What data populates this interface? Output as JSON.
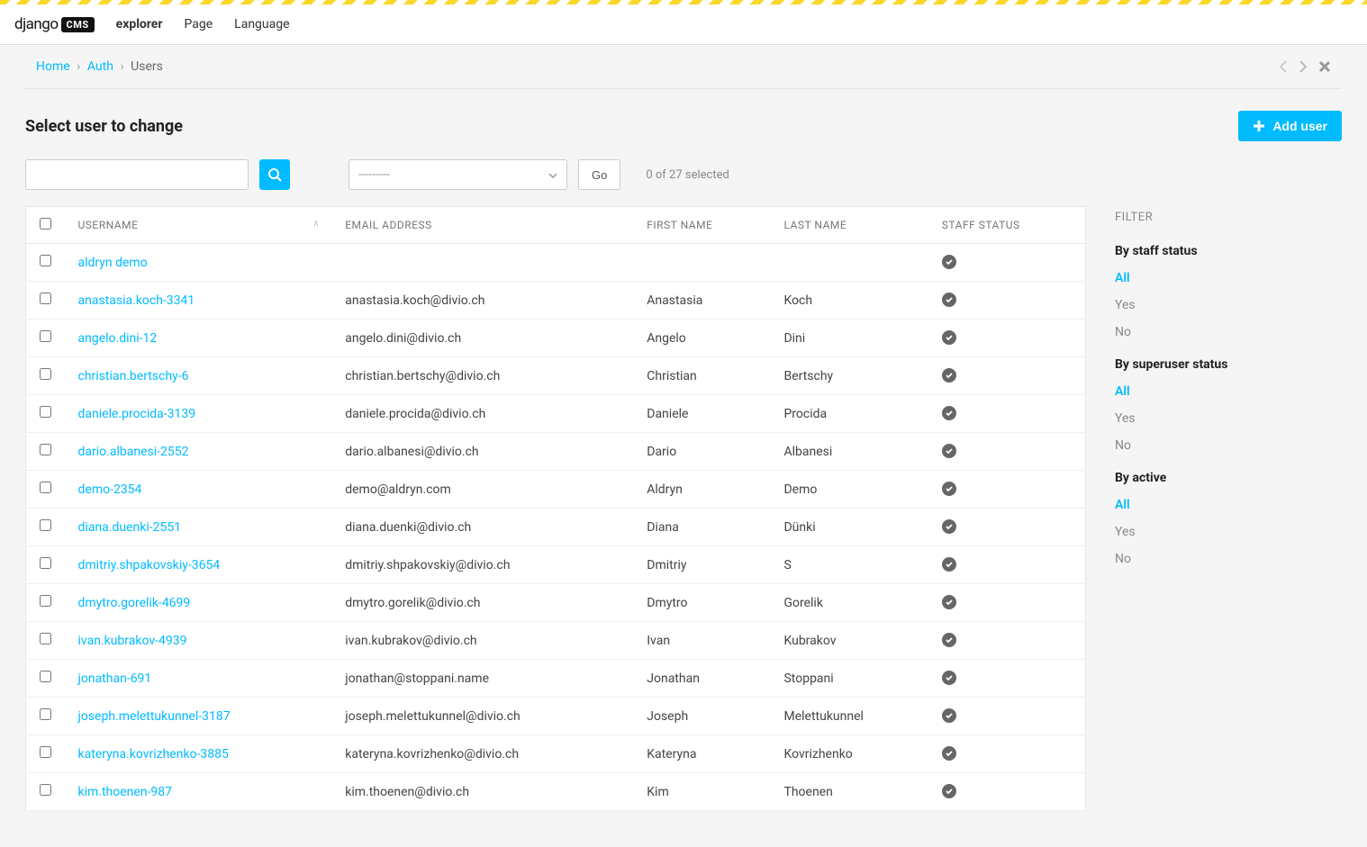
{
  "toolbar": {
    "brand_text": "django",
    "brand_badge": "CMS",
    "items": [
      "explorer",
      "Page",
      "Language"
    ]
  },
  "breadcrumb": {
    "home": "Home",
    "auth": "Auth",
    "current": "Users"
  },
  "page_title": "Select user to change",
  "add_button": "Add user",
  "action_select_placeholder": "---------",
  "go_button": "Go",
  "selection_status": "0 of 27 selected",
  "columns": {
    "username": "USERNAME",
    "email": "EMAIL ADDRESS",
    "first_name": "FIRST NAME",
    "last_name": "LAST NAME",
    "staff_status": "STAFF STATUS"
  },
  "rows": [
    {
      "username": "aldryn demo",
      "email": "",
      "first_name": "",
      "last_name": "",
      "staff": true
    },
    {
      "username": "anastasia.koch-3341",
      "email": "anastasia.koch@divio.ch",
      "first_name": "Anastasia",
      "last_name": "Koch",
      "staff": true
    },
    {
      "username": "angelo.dini-12",
      "email": "angelo.dini@divio.ch",
      "first_name": "Angelo",
      "last_name": "Dini",
      "staff": true
    },
    {
      "username": "christian.bertschy-6",
      "email": "christian.bertschy@divio.ch",
      "first_name": "Christian",
      "last_name": "Bertschy",
      "staff": true
    },
    {
      "username": "daniele.procida-3139",
      "email": "daniele.procida@divio.ch",
      "first_name": "Daniele",
      "last_name": "Procida",
      "staff": true
    },
    {
      "username": "dario.albanesi-2552",
      "email": "dario.albanesi@divio.ch",
      "first_name": "Dario",
      "last_name": "Albanesi",
      "staff": true
    },
    {
      "username": "demo-2354",
      "email": "demo@aldryn.com",
      "first_name": "Aldryn",
      "last_name": "Demo",
      "staff": true
    },
    {
      "username": "diana.duenki-2551",
      "email": "diana.duenki@divio.ch",
      "first_name": "Diana",
      "last_name": "Dünki",
      "staff": true
    },
    {
      "username": "dmitriy.shpakovskiy-3654",
      "email": "dmitriy.shpakovskiy@divio.ch",
      "first_name": "Dmitriy",
      "last_name": "S",
      "staff": true
    },
    {
      "username": "dmytro.gorelik-4699",
      "email": "dmytro.gorelik@divio.ch",
      "first_name": "Dmytro",
      "last_name": "Gorelik",
      "staff": true
    },
    {
      "username": "ivan.kubrakov-4939",
      "email": "ivan.kubrakov@divio.ch",
      "first_name": "Ivan",
      "last_name": "Kubrakov",
      "staff": true
    },
    {
      "username": "jonathan-691",
      "email": "jonathan@stoppani.name",
      "first_name": "Jonathan",
      "last_name": "Stoppani",
      "staff": true
    },
    {
      "username": "joseph.melettukunnel-3187",
      "email": "joseph.melettukunnel@divio.ch",
      "first_name": "Joseph",
      "last_name": "Melettukunnel",
      "staff": true
    },
    {
      "username": "kateryna.kovrizhenko-3885",
      "email": "kateryna.kovrizhenko@divio.ch",
      "first_name": "Kateryna",
      "last_name": "Kovrizhenko",
      "staff": true
    },
    {
      "username": "kim.thoenen-987",
      "email": "kim.thoenen@divio.ch",
      "first_name": "Kim",
      "last_name": "Thoenen",
      "staff": true
    }
  ],
  "filter": {
    "heading": "FILTER",
    "groups": [
      {
        "title": "By staff status",
        "options": [
          "All",
          "Yes",
          "No"
        ],
        "active": "All"
      },
      {
        "title": "By superuser status",
        "options": [
          "All",
          "Yes",
          "No"
        ],
        "active": "All"
      },
      {
        "title": "By active",
        "options": [
          "All",
          "Yes",
          "No"
        ],
        "active": "All"
      }
    ]
  }
}
